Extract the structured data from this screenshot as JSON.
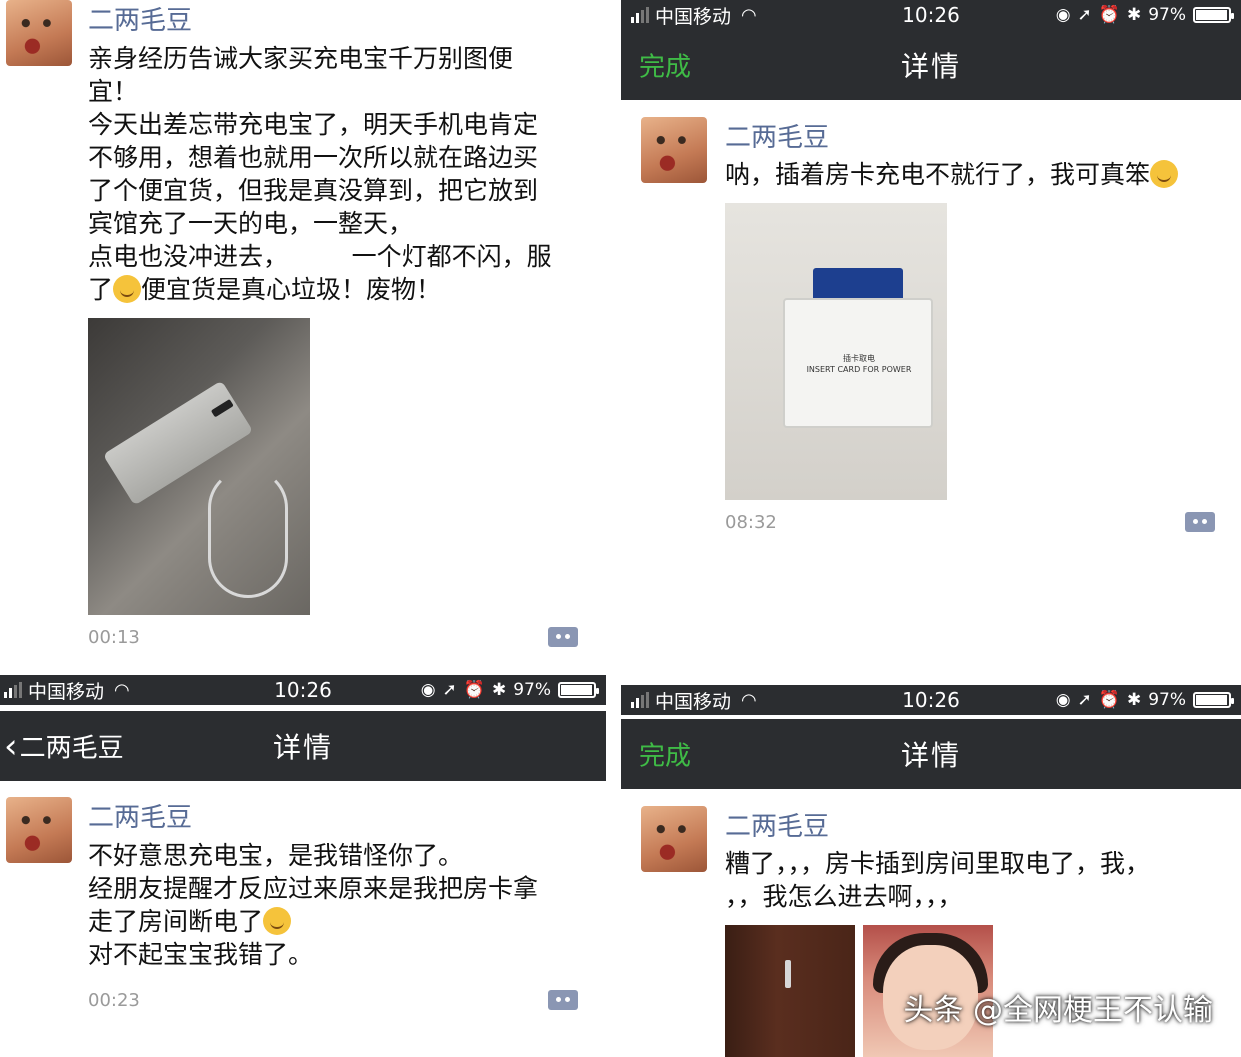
{
  "status": {
    "carrier": "中国移动",
    "time": "10:26",
    "battery": "97%",
    "battery_level": 0.97
  },
  "panel1": {
    "username": "二两毛豆",
    "lines": [
      "亲身经历告诫大家买充电宝千万别图便",
      "宜！",
      "今天出差忘带充电宝了，明天手机电肯定",
      "不够用，想着也就用一次所以就在路边买",
      "了个便宜货，但我是真没算到，把它放到",
      "宾馆充了一天的电，一整天，",
      "点电也没冲进去，        一个灯都不闪，服"
    ],
    "last_line_before": "了",
    "last_line_after": "便宜货是真心垃圾！废物！",
    "timestamp": "00:13"
  },
  "panel2": {
    "nav_done": "完成",
    "nav_title": "详情",
    "username": "二两毛豆",
    "text": "呐，插着房卡充电不就行了，我可真笨",
    "timestamp": "08:32",
    "card_slot_text": "插卡取电\nINSERT CARD FOR POWER"
  },
  "panel3": {
    "nav_back": "二两毛豆",
    "nav_title": "详情",
    "username": "二两毛豆",
    "line1": "不好意思充电宝，是我错怪你了。",
    "line2": "经朋友提醒才反应过来原来是我把房卡拿",
    "line3": "走了房间断电了",
    "line4": "对不起宝宝我错了。",
    "timestamp": "00:23"
  },
  "panel4": {
    "nav_done": "完成",
    "nav_title": "详情",
    "username": "二两毛豆",
    "line1": "糟了，，，房卡插到房间里取电了，我，",
    "line2": "，，我怎么进去啊，，，"
  },
  "watermark": "头条 @全网梗王不认输"
}
